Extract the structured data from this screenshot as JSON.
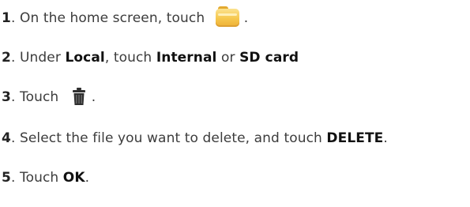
{
  "steps": [
    {
      "number": "1",
      "text_before": "On the home screen, touch",
      "icon": "file-manager-folder-icon",
      "text_after": "."
    },
    {
      "number": "2",
      "t1": "Under ",
      "b1": "Local",
      "t2": ", touch ",
      "b2": "Internal",
      "t3": " or ",
      "b3": "SD card"
    },
    {
      "number": "3",
      "text_before": "Touch",
      "icon": "trash-can-icon",
      "text_after": "."
    },
    {
      "number": "4",
      "t1": "Select the file you want to delete, and touch ",
      "b1": "DELETE",
      "t2": "."
    },
    {
      "number": "5",
      "t1": "Touch ",
      "b1": "OK",
      "t2": "."
    }
  ],
  "colors": {
    "text": "#3c3c3c",
    "folder_icon": "#f6c74d",
    "trash_icon": "#2f2f2f"
  }
}
